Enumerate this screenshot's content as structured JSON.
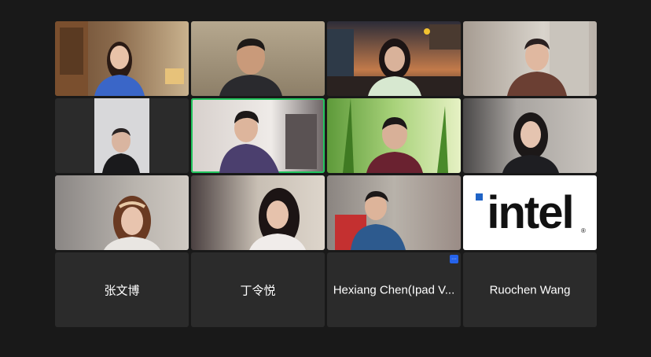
{
  "participants": [
    {
      "name": "",
      "video": "woman-blue-top"
    },
    {
      "name": "",
      "video": "man-dark-shirt"
    },
    {
      "name": "",
      "video": "woman-headset-city"
    },
    {
      "name": "",
      "video": "older-man-glasses"
    },
    {
      "name": "",
      "video": "man-adjusting-glasses"
    },
    {
      "name": "",
      "video": "young-man-purple-sweater"
    },
    {
      "name": "",
      "video": "man-grass-background"
    },
    {
      "name": "",
      "video": "woman-dark-hair"
    },
    {
      "name": "",
      "video": "girl-headband"
    },
    {
      "name": "",
      "video": "girl-long-hair"
    },
    {
      "name": "",
      "video": "man-blue-jacket"
    },
    {
      "name": "",
      "video": "intel-logo"
    },
    {
      "name": "张文博",
      "video": "none"
    },
    {
      "name": "丁令悦",
      "video": "none"
    },
    {
      "name": "Hexiang Chen(Ipad V...",
      "video": "none",
      "badge": "···"
    },
    {
      "name": "Ruochen Wang",
      "video": "none"
    }
  ],
  "intel_logo": {
    "text": "intel",
    "accent": "#1f63c6"
  },
  "colors": {
    "background": "#191919",
    "active_speaker": "#22c55e",
    "tile": "#2b2b2b"
  }
}
